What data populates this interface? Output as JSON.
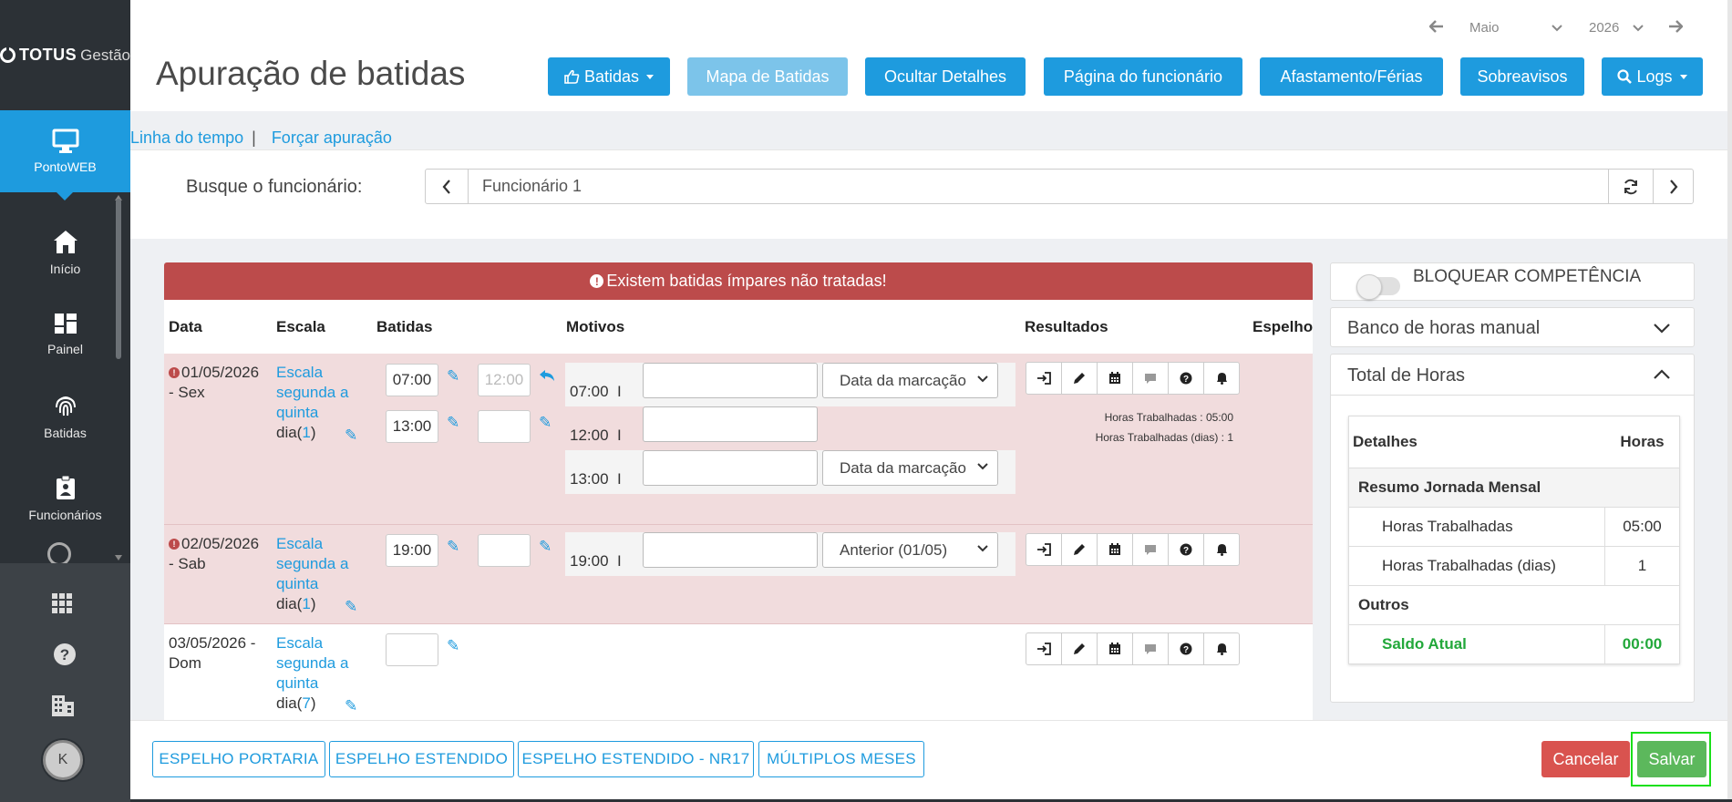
{
  "brand": {
    "logo_bold": "TOTUS",
    "logo_light": "Gestão"
  },
  "sidebar": {
    "active": {
      "label": "PontoWEB",
      "icon": "monitor-icon"
    },
    "items": [
      {
        "label": "Início",
        "icon": "home-icon"
      },
      {
        "label": "Painel",
        "icon": "dashboard-icon"
      },
      {
        "label": "Batidas",
        "icon": "fingerprint-icon"
      },
      {
        "label": "Funcionários",
        "icon": "id-badge-icon"
      }
    ],
    "bottom_icons": [
      "apps-grid-icon",
      "help-icon",
      "building-icon"
    ],
    "avatar_initial": "K"
  },
  "header": {
    "title": "Apuração de batidas",
    "month": "Maio",
    "year": "2026",
    "buttons": [
      {
        "label": "Batidas",
        "icon": "thumbs-up-icon",
        "dropdown": true
      },
      {
        "label": "Mapa de Batidas"
      },
      {
        "label": "Ocultar Detalhes"
      },
      {
        "label": "Página do funcionário"
      },
      {
        "label": "Afastamento/Férias"
      },
      {
        "label": "Sobreavisos"
      },
      {
        "label": "Logs",
        "icon": "search-icon",
        "dropdown": true
      }
    ]
  },
  "links": {
    "timeline": "Linha do tempo",
    "separator": "|",
    "force": "Forçar apuração"
  },
  "search": {
    "label": "Busque o funcionário:",
    "value": "Funcionário 1"
  },
  "alert": {
    "text": "Existem batidas ímpares não tratadas!"
  },
  "table": {
    "headers": {
      "data": "Data",
      "escala": "Escala",
      "batidas": "Batidas",
      "motivos": "Motivos",
      "resultados": "Resultados",
      "espelho": "Espelho"
    },
    "rows": [
      {
        "date": "01/05/2026",
        "weekday": "- Sex",
        "escala": [
          "Escala",
          "segunda a",
          "quinta"
        ],
        "escala_dia": "dia(",
        "escala_num": "1",
        "escala_close": ")",
        "batidas": [
          "07:00",
          "12:00",
          "13:00",
          ""
        ],
        "motivos": [
          {
            "time": "07:00",
            "sep": "I",
            "select": "Data da marcação"
          },
          {
            "time": "12:00",
            "sep": "I",
            "select": ""
          },
          {
            "time": "13:00",
            "sep": "I",
            "select": "Data da marcação"
          }
        ],
        "resultados": [
          "Horas Trabalhadas : 05:00",
          "Horas Trabalhadas (dias) : 1"
        ]
      },
      {
        "date": "02/05/2026",
        "weekday": "- Sab",
        "escala": [
          "Escala",
          "segunda a",
          "quinta"
        ],
        "escala_dia": "dia(",
        "escala_num": "1",
        "escala_close": ")",
        "batidas": [
          "19:00",
          ""
        ],
        "motivos": [
          {
            "time": "19:00",
            "sep": "I",
            "select": "Anterior (01/05)"
          }
        ]
      },
      {
        "date": "03/05/2026 -",
        "weekday": "Dom",
        "escala": [
          "Escala",
          "segunda a",
          "quinta"
        ],
        "escala_dia": "dia(",
        "escala_num": "7",
        "escala_close": ")",
        "batidas": [
          ""
        ]
      }
    ],
    "action_icons": [
      "sign-in-icon",
      "pencil-icon",
      "calendar-icon",
      "comment-icon",
      "question-icon",
      "bell-icon"
    ]
  },
  "right_panel": {
    "lock_label": "BLOQUEAR COMPETÊNCIA",
    "banco_title": "Banco de horas manual",
    "total_title": "Total de Horas",
    "table": {
      "col_detalhes": "Detalhes",
      "col_horas": "Horas",
      "section1": "Resumo Jornada Mensal",
      "rows1": [
        {
          "label": "Horas Trabalhadas",
          "value": "05:00"
        },
        {
          "label": "Horas Trabalhadas (dias)",
          "value": "1"
        }
      ],
      "section2": "Outros",
      "saldo_label": "Saldo Atual",
      "saldo_value": "00:00"
    }
  },
  "footer": {
    "buttons": [
      "ESPELHO PORTARIA",
      "ESPELHO ESTENDIDO",
      "ESPELHO ESTENDIDO - NR17",
      "MÚLTIPLOS MESES"
    ],
    "cancel": "Cancelar",
    "save": "Salvar"
  },
  "colors": {
    "primary": "#1e9bde",
    "sidebar": "#2c3136",
    "alert": "#bc4b4b",
    "error_row": "#f1dcdd",
    "cancel": "#d9534f",
    "save": "#5cb85c",
    "saldo": "#22a83a"
  }
}
